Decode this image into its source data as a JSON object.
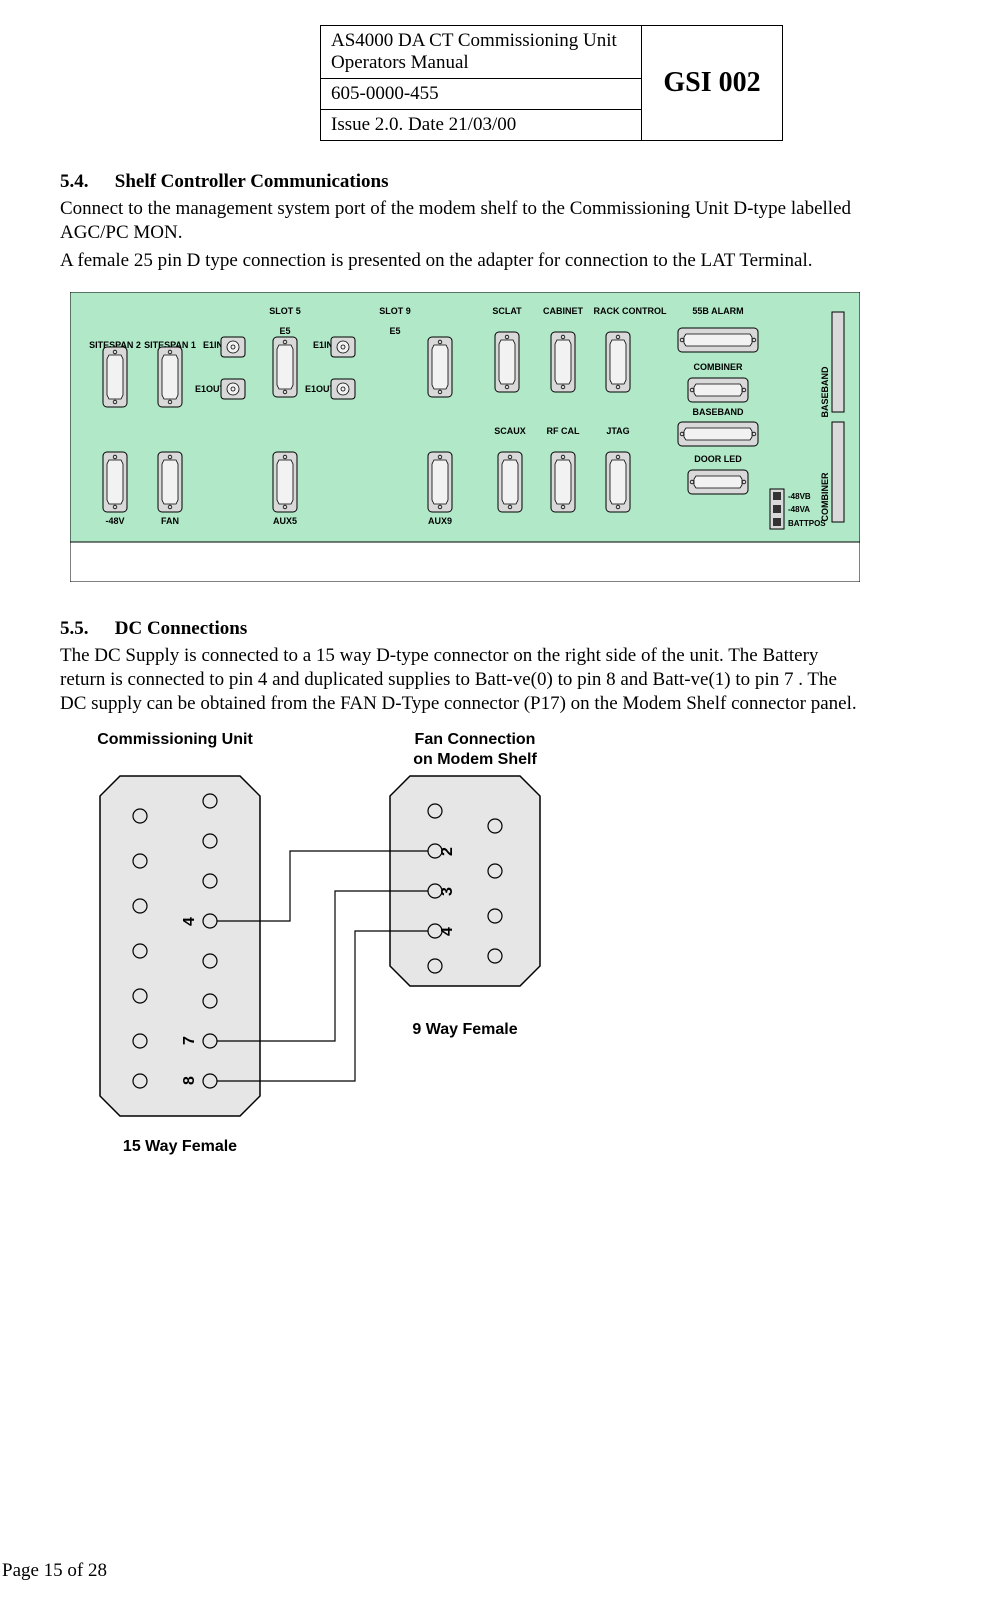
{
  "header": {
    "title_line1": "AS4000 DA CT Commissioning Unit",
    "title_line2": "Operators Manual",
    "docnum": "605-0000-455",
    "issue": "Issue 2.0.  Date 21/03/00",
    "code": "GSI 002"
  },
  "s54": {
    "num": "5.4.",
    "title": "Shelf Controller Communications",
    "p1": " Connect to the management system port of the modem shelf to the Commissioning Unit D-type labelled AGC/PC MON.",
    "p2": "A female 25 pin D type connection is presented on the adapter for connection to the LAT Terminal."
  },
  "panel": {
    "slot5": "SLOT 5",
    "slot9": "SLOT 9",
    "sitespan2": "SITESPAN 2",
    "sitespan1": "SITESPAN 1",
    "e1in": "E1IN",
    "e5": "E5",
    "e1out": "E1OUT",
    "sclat": "SCLAT",
    "cabinet": "CABINET",
    "rackcontrol": "RACK CONTROL",
    "alarm55b": "55B ALARM",
    "combiner": "COMBINER",
    "baseband": "BASEBAND",
    "scaux": "SCAUX",
    "rfcal": "RF CAL",
    "jtag": "JTAG",
    "doorled": "DOOR LED",
    "neg48v": "-48V",
    "fan": "FAN",
    "aux5": "AUX5",
    "aux9": "AUX9",
    "neg48vb": "-48VB",
    "neg48va": "-48VA",
    "battpos": "BATTPOS",
    "side_baseband": "BASEBAND",
    "side_combiner": "COMBINER"
  },
  "s55": {
    "num": "5.5.",
    "title": "DC Connections",
    "p1": "The DC Supply is connected to a 15 way D-type connector on the right side of the unit. The Battery return is connected to pin 4 and duplicated supplies to Batt-ve(0) to pin 8  and Batt-ve(1) to pin 7 . The DC supply can be obtained from the FAN D-Type connector (P17) on the Modem Shelf connector panel."
  },
  "fig": {
    "left_title": "Commissioning Unit",
    "right_title_l1": "Fan Connection",
    "right_title_l2": "on Modem Shelf",
    "left_caption": "15 Way Female",
    "right_caption": "9 Way Female",
    "pin4": "4",
    "pin7": "7",
    "pin8": "8",
    "pin2": "2",
    "pin3": "3",
    "pin4r": "4"
  },
  "footer": {
    "page": "Page 15 of 28"
  }
}
